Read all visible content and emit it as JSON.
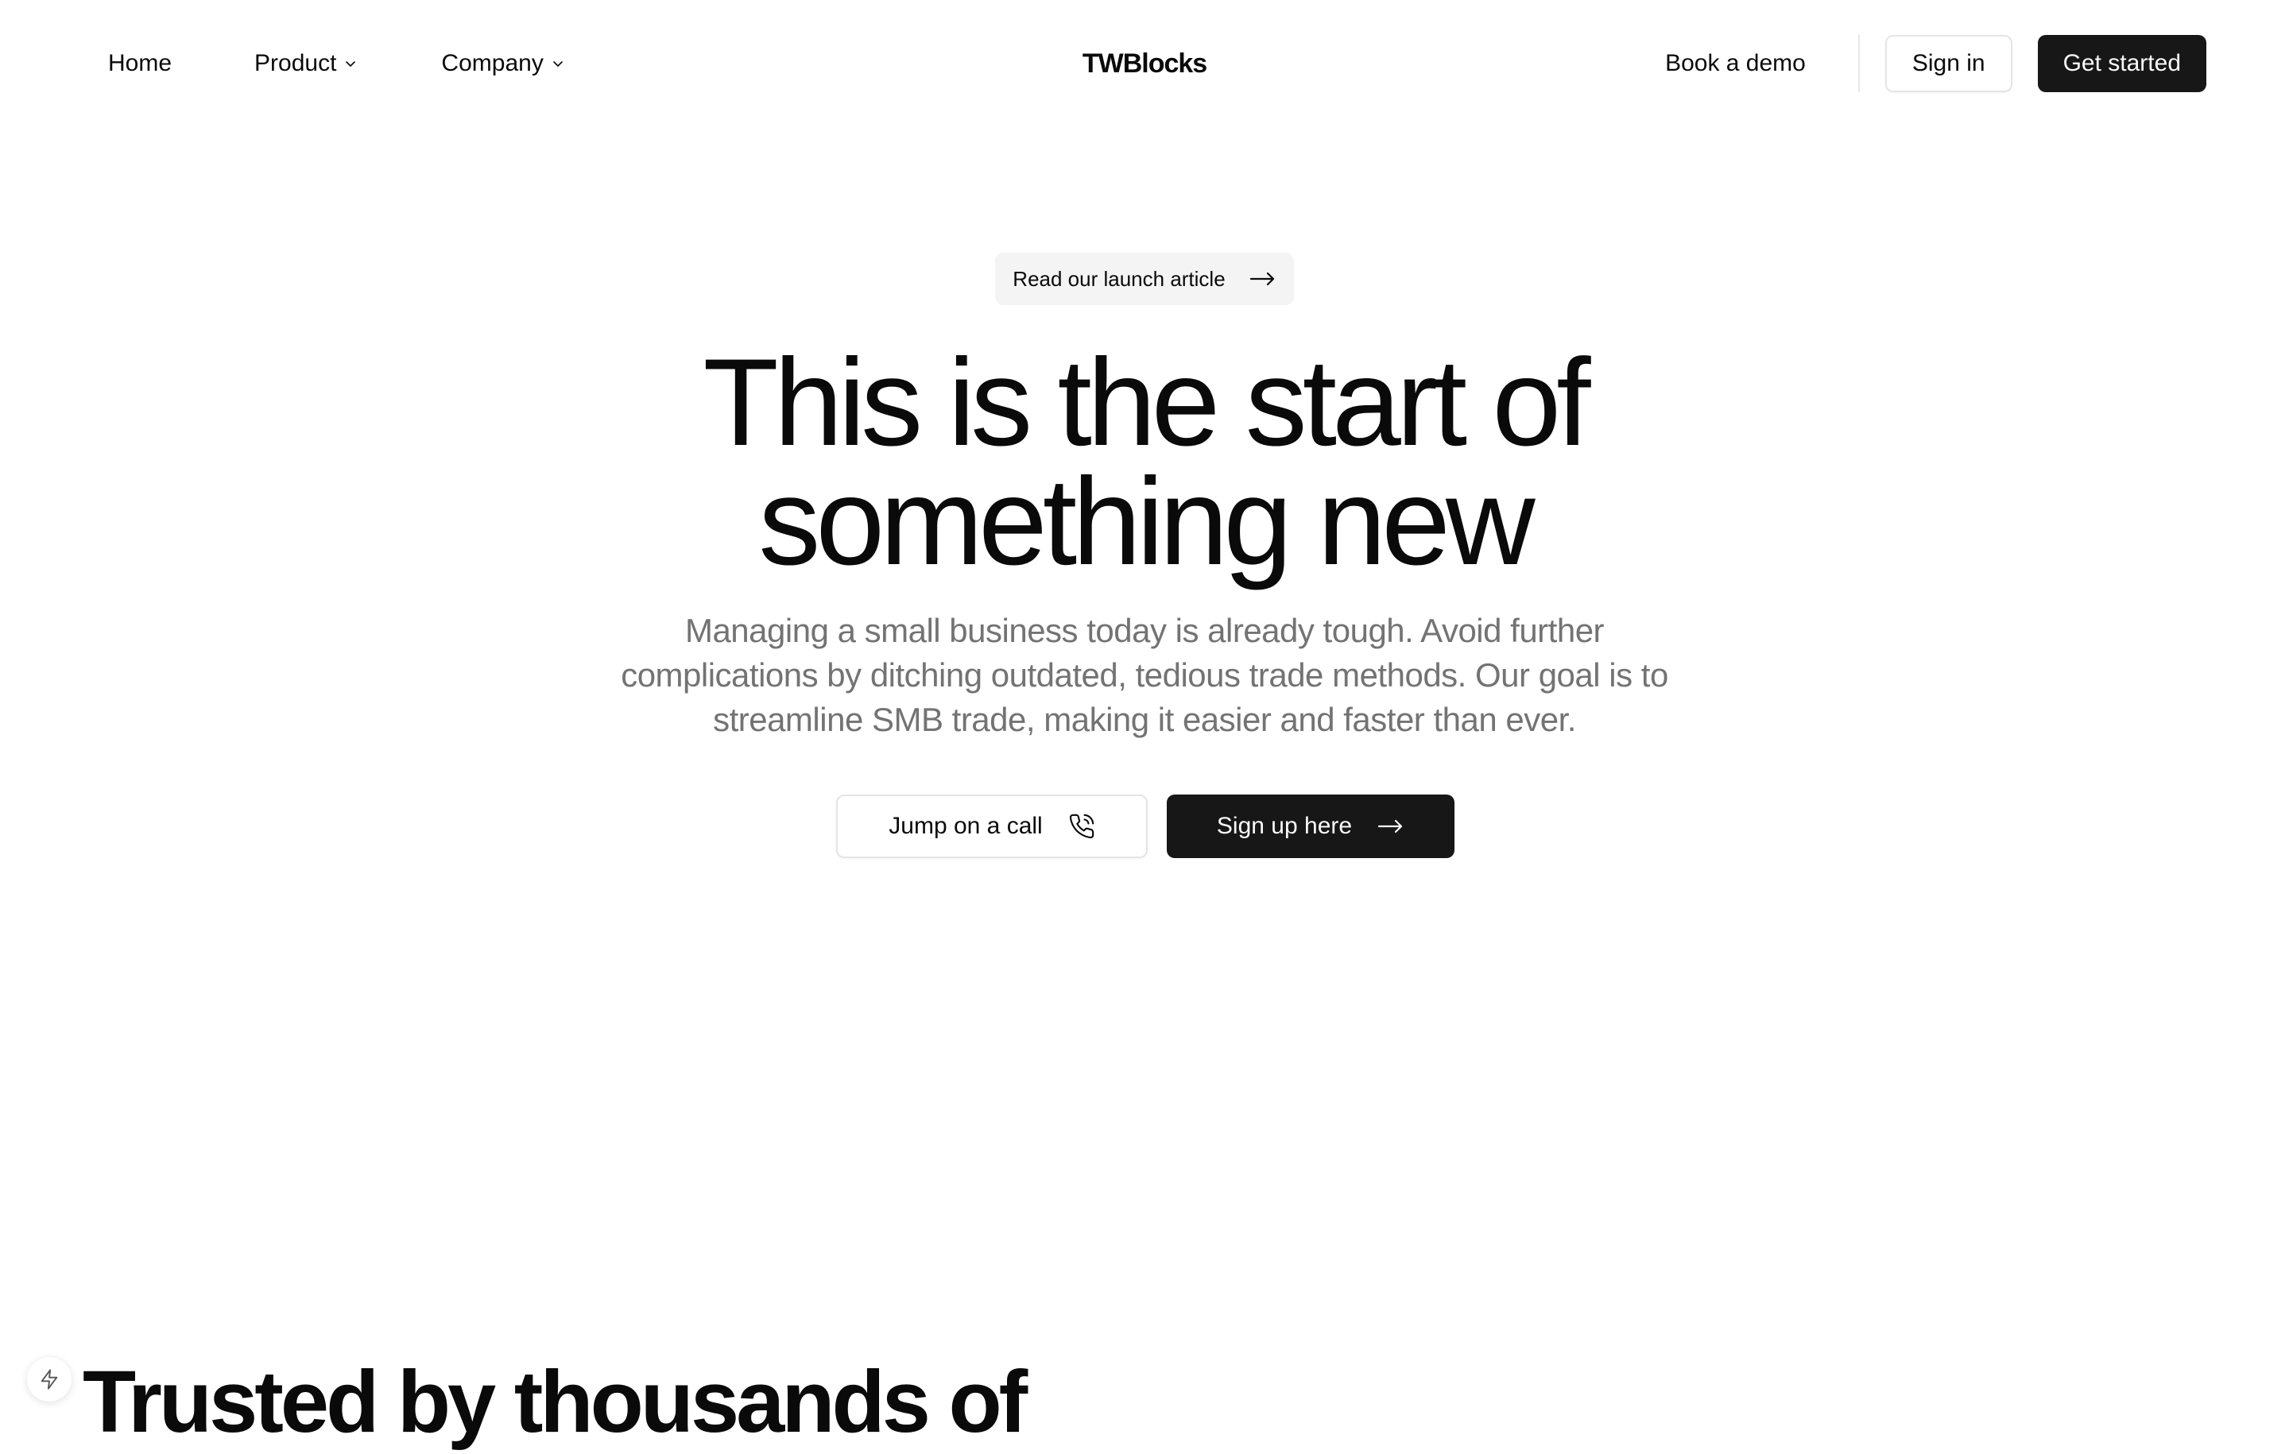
{
  "header": {
    "nav": {
      "home": "Home",
      "product": "Product",
      "company": "Company"
    },
    "brand": "TWBlocks",
    "book_demo": "Book a demo",
    "sign_in": "Sign in",
    "get_started": "Get started"
  },
  "hero": {
    "pill_label": "Read our launch article",
    "headline_line1": "This is the start of",
    "headline_line2": "something new",
    "subtext": "Managing a small business today is already tough. Avoid further complications by ditching outdated, tedious trade methods. Our goal is to streamline SMB trade, making it easier and faster than ever.",
    "cta_call": "Jump on a call",
    "cta_signup": "Sign up here"
  },
  "trusted": {
    "heading": "Trusted by thousands of"
  },
  "icons": {
    "chevron": "chevron-down-icon",
    "arrow": "arrow-right-icon",
    "phone": "phone-call-icon",
    "bolt": "lightning-icon"
  },
  "colors": {
    "text": "#0a0a0a",
    "muted": "#737373",
    "primary_button": "#171717",
    "pill_bg": "#f4f4f5",
    "border": "#e5e5e5"
  }
}
